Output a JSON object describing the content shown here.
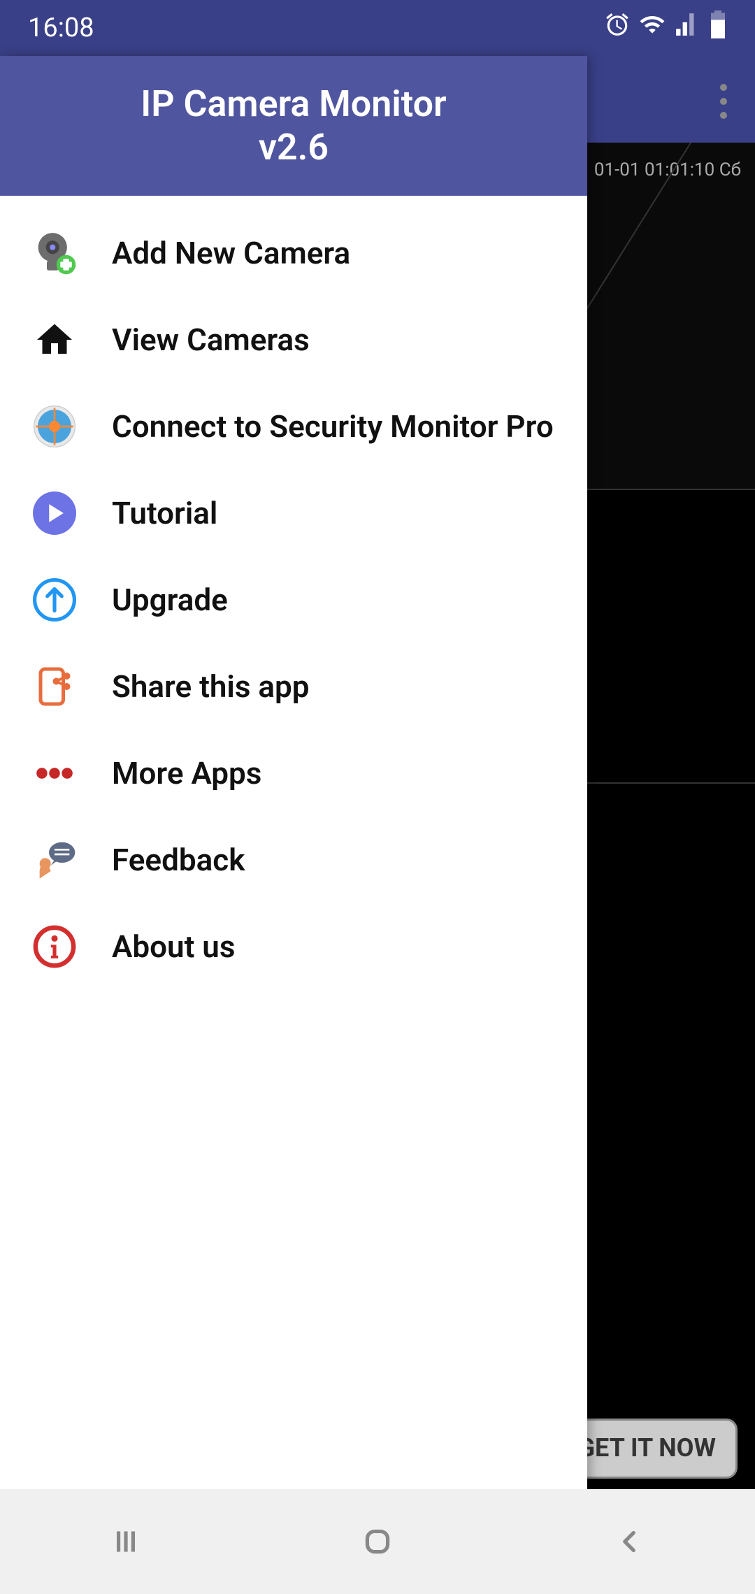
{
  "status_bar": {
    "time": "16:08"
  },
  "drawer": {
    "title_line1": "IP Camera Monitor",
    "title_line2": "v2.6",
    "menu_items": [
      {
        "label": "Add New Camera"
      },
      {
        "label": "View Cameras"
      },
      {
        "label": "Connect to Security Monitor Pro"
      },
      {
        "label": "Tutorial"
      },
      {
        "label": "Upgrade"
      },
      {
        "label": "Share this app"
      },
      {
        "label": "More Apps"
      },
      {
        "label": "Feedback"
      },
      {
        "label": "About us"
      }
    ]
  },
  "background": {
    "camera_timestamp": "01-01 01:01:10 Сб",
    "get_it_button": "GET IT NOW"
  }
}
